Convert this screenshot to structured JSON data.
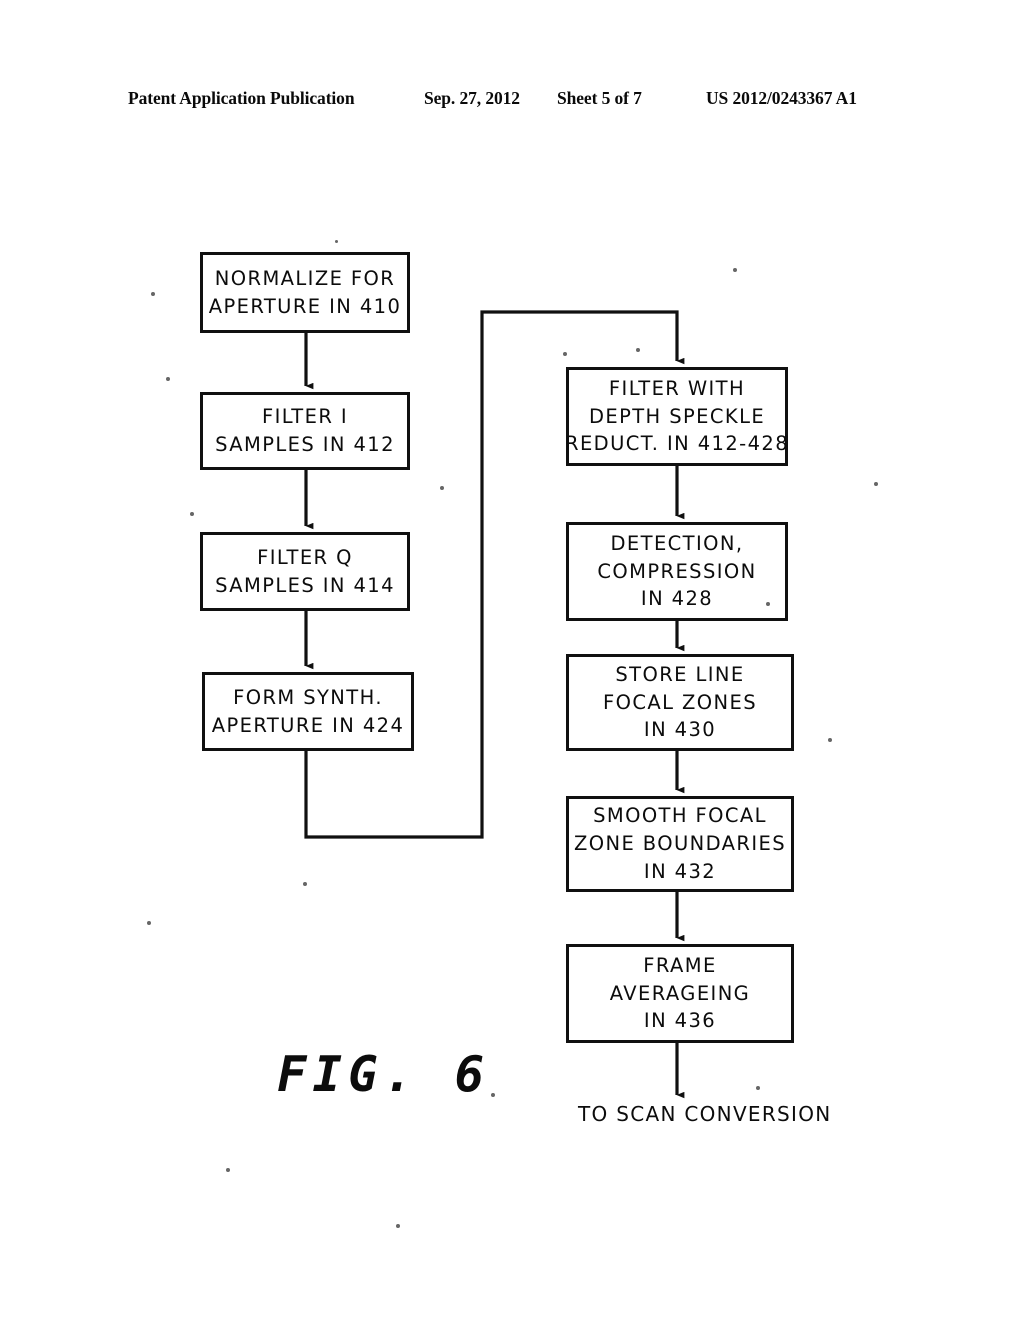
{
  "header": {
    "publication": "Patent Application Publication",
    "date": "Sep. 27, 2012",
    "sheet": "Sheet 5 of 7",
    "patent_number": "US 2012/0243367 A1"
  },
  "figure": {
    "caption": "FIG. 6",
    "terminal_label": "TO SCAN CONVERSION"
  },
  "flowchart": {
    "left_column": [
      {
        "id": "normalize",
        "line1": "NORMALIZE FOR",
        "line2": "APERTURE IN 410",
        "line3": ""
      },
      {
        "id": "filter_i",
        "line1": "FILTER I",
        "line2": "SAMPLES IN 412",
        "line3": ""
      },
      {
        "id": "filter_q",
        "line1": "FILTER Q",
        "line2": "SAMPLES IN 414",
        "line3": ""
      },
      {
        "id": "form_synth",
        "line1": "FORM SYNTH.",
        "line2": "APERTURE IN 424",
        "line3": ""
      }
    ],
    "right_column": [
      {
        "id": "filter_depth",
        "line1": "FILTER WITH",
        "line2": "DEPTH SPECKLE",
        "line3": "REDUCT. IN 412-428"
      },
      {
        "id": "detection",
        "line1": "DETECTION,",
        "line2": "COMPRESSION",
        "line3": "IN 428"
      },
      {
        "id": "store_line",
        "line1": "STORE LINE",
        "line2": "FOCAL ZONES",
        "line3": "IN 430"
      },
      {
        "id": "smooth_focal",
        "line1": "SMOOTH FOCAL",
        "line2": "ZONE BOUNDARIES",
        "line3": "IN 432"
      },
      {
        "id": "frame_avg",
        "line1": "FRAME",
        "line2": "AVERAGEING",
        "line3": "IN 436"
      }
    ]
  },
  "colors": {
    "ink": "#0c0c0c",
    "page": "#ffffff"
  }
}
